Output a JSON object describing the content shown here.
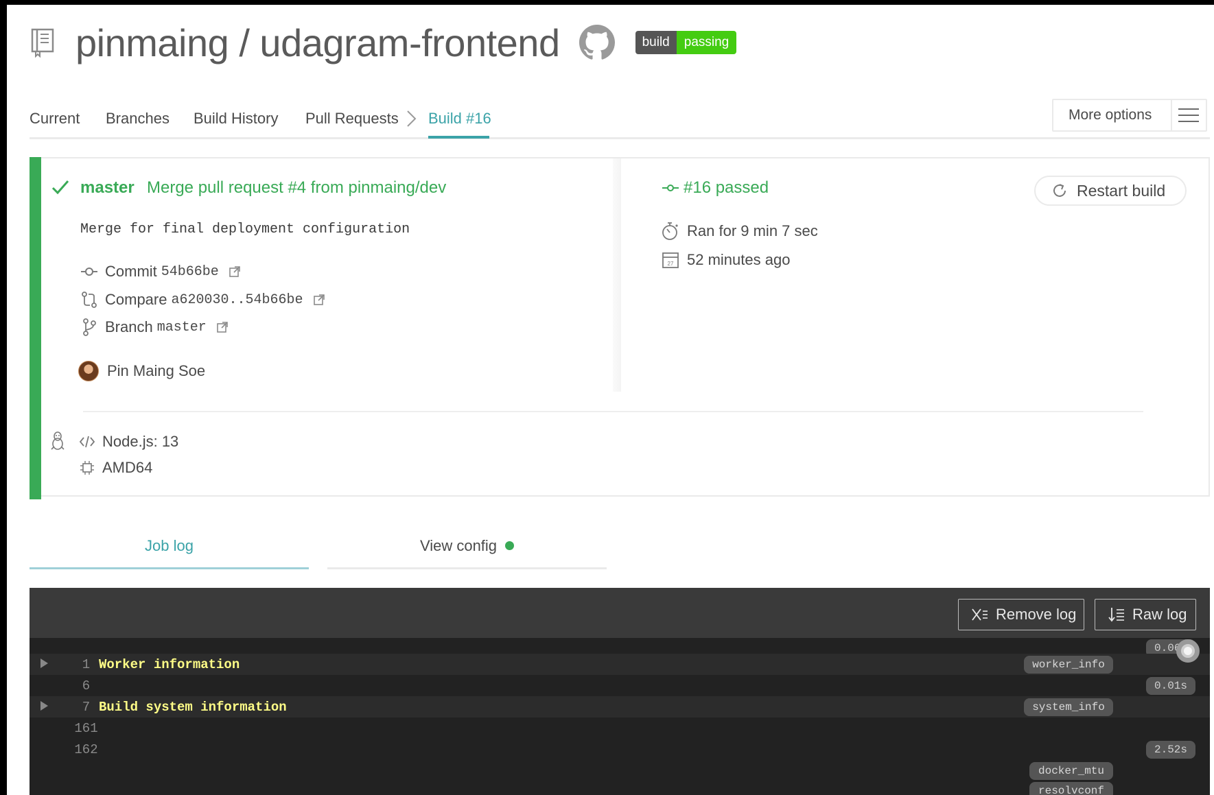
{
  "repo": {
    "title": "pinmaing / udagram-frontend",
    "badge_left": "build",
    "badge_right": "passing",
    "badge_color": "#44cc11"
  },
  "nav": {
    "items": [
      "Current",
      "Branches",
      "Build History",
      "Pull Requests",
      "Build #16"
    ],
    "active": "Build #16",
    "more_options": "More options"
  },
  "build": {
    "branch": "master",
    "commit_title": "Merge pull request #4 from pinmaing/dev",
    "commit_message": "Merge for final deployment configuration",
    "commit_label": "Commit",
    "commit_sha": "54b66be",
    "compare_label": "Compare",
    "compare_range": "a620030..54b66be",
    "branch_label": "Branch",
    "branch_value": "master",
    "author": "Pin Maing Soe",
    "status": "#16 passed",
    "duration": "Ran for 9 min 7 sec",
    "finished": "52 minutes ago",
    "calendar_day": "27",
    "restart_label": "Restart build",
    "language": "Node.js: 13",
    "arch": "AMD64",
    "status_color": "#39aa56"
  },
  "tabs": {
    "job_log": "Job log",
    "view_config": "View config"
  },
  "log": {
    "remove_label": "Remove log",
    "raw_label": "Raw log",
    "lines": [
      {
        "num": "1",
        "text": "Worker information",
        "fold": true,
        "tag": "worker_info",
        "time": "0.06s"
      },
      {
        "num": "6",
        "text": "",
        "fold": false,
        "tag": "",
        "time": "0.01s"
      },
      {
        "num": "7",
        "text": "Build system information",
        "fold": true,
        "tag": "system_info",
        "time": ""
      },
      {
        "num": "161",
        "text": "",
        "fold": false,
        "tag": "",
        "time": ""
      },
      {
        "num": "162",
        "text": "",
        "fold": false,
        "tag": "",
        "time": "2.52s"
      }
    ],
    "extra_tags": [
      "docker_mtu",
      "resolvconf"
    ]
  }
}
